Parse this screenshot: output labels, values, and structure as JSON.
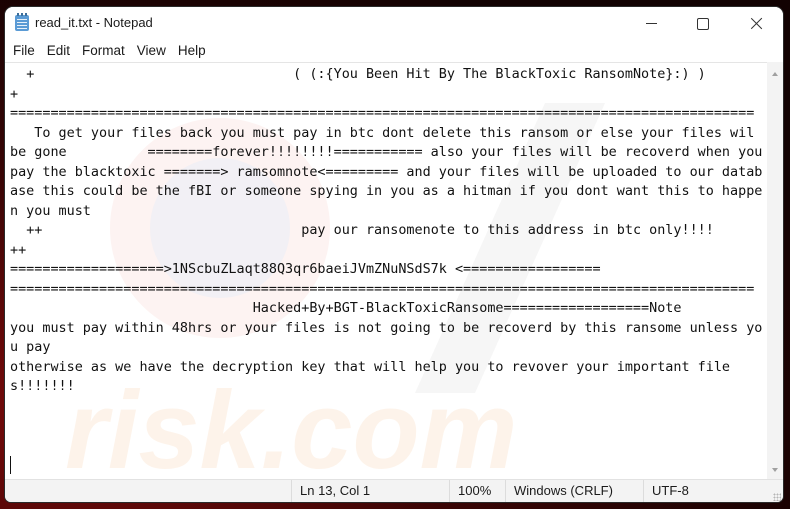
{
  "window": {
    "title": "read_it.txt - Notepad",
    "app_icon": "notepad-icon",
    "controls": {
      "minimize": "minimize-icon",
      "maximize": "maximize-icon",
      "close": "close-icon"
    }
  },
  "menu": {
    "items": [
      {
        "label": "File"
      },
      {
        "label": "Edit"
      },
      {
        "label": "Format"
      },
      {
        "label": "View"
      },
      {
        "label": "Help"
      }
    ]
  },
  "editor": {
    "content": "  +                                ( (:{You Been Hit By The BlackToxic RansomNote}:) )                                                +\n============================================================================================\n   To get your files back you must pay in btc dont delete this ransom or else your files wil be gone          ========forever!!!!!!!!=========== also your files will be recoverd when you pay the blacktoxic =======> ramsomnote<========= and your files will be uploaded to our database this could be the fBI or someone spying in you as a hitman if you dont want this to happen you must\n  ++                                pay our ransomenote to this address in btc only!!!!                              ++\n===================>1NScbuZLaqt88Q3qr6baeiJVmZNuNSdS7k <=================\n============================================================================================\n                              Hacked+By+BGT-BlackToxicRansome==================Note\nyou must pay within 48hrs or your files is not going to be recoverd by this ransome unless you pay\notherwise as we have the decryption key that will help you to revover your important files!!!!!!!\n\n"
  },
  "statusbar": {
    "position": "Ln 13, Col 1",
    "zoom": "100%",
    "line_ending": "Windows (CRLF)",
    "encoding": "UTF-8"
  }
}
